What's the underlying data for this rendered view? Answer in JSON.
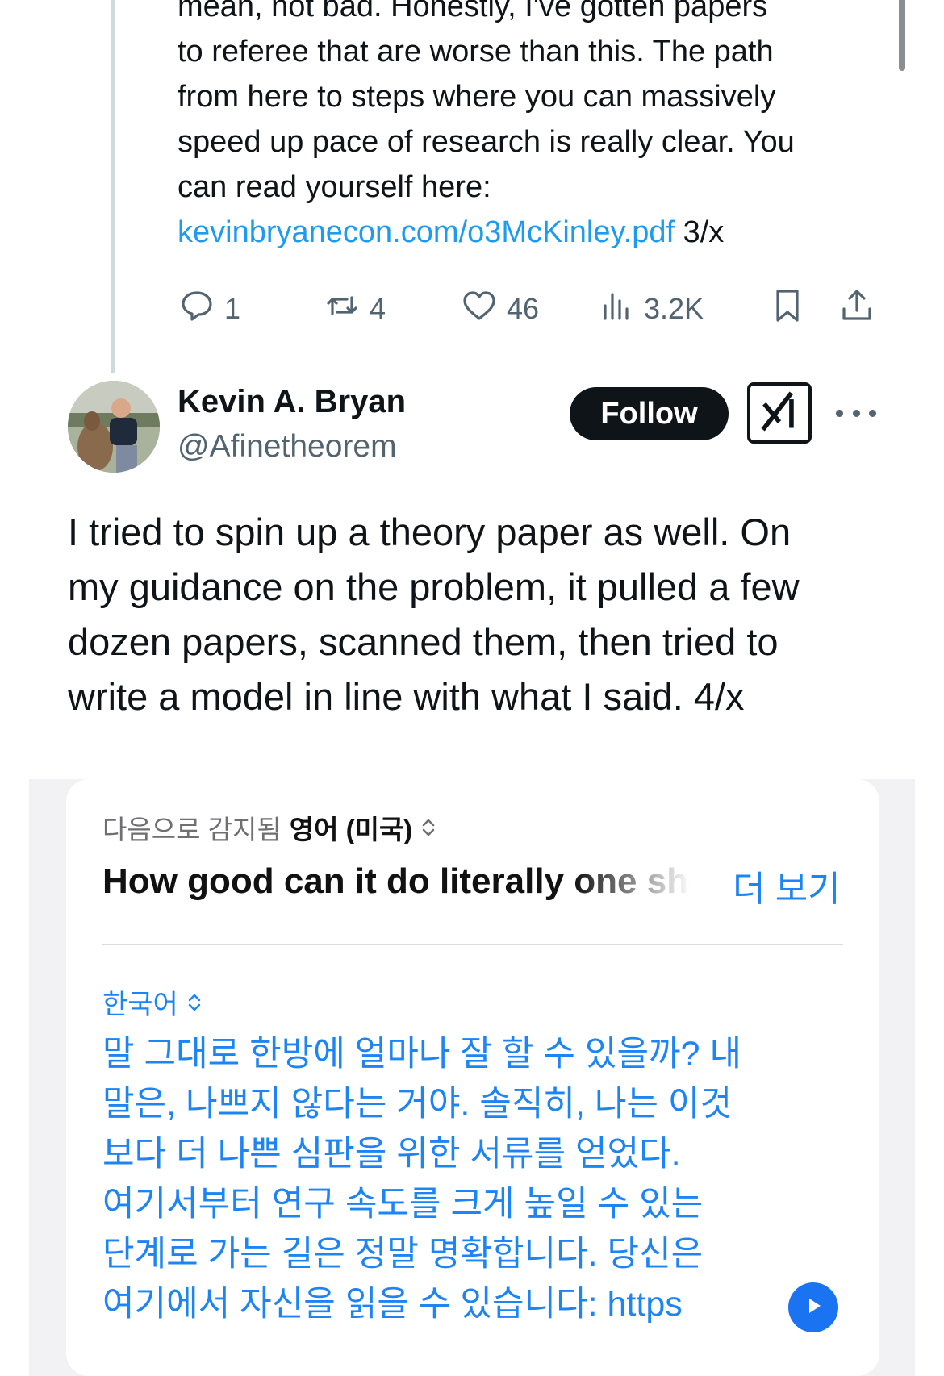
{
  "prev_tweet": {
    "lines": [
      "mean, not bad. Honestly, I've gotten papers",
      "to referee that are worse than this. The path",
      "from here to steps where you can massively",
      "speed up pace of research is really clear. You",
      "can read yourself here:"
    ],
    "link_text": "kevinbryanecon.com/o3McKinley.pdf",
    "suffix": " 3/x",
    "actions": {
      "replies": "1",
      "reposts": "4",
      "likes": "46",
      "views": "3.2K"
    }
  },
  "tweet": {
    "author_name": "Kevin A. Bryan",
    "author_handle": "@Afinetheorem",
    "follow_label": "Follow",
    "lines": [
      "I tried to spin up a theory paper as well. On",
      "my guidance on the problem, it pulled a few",
      "dozen papers, scanned them, then tried to",
      "write a model in line with what I said.  4/x"
    ]
  },
  "translation": {
    "detected_prefix": "다음으로 감지됨",
    "detected_language": "영어 (미국)",
    "source_text": "How good can it do literally one shot?",
    "see_more": "더 보기",
    "target_language": "한국어",
    "target_lines": [
      "말 그대로 한방에 얼마나 잘 할 수 있을까? 내",
      "말은, 나쁘지 않다는 거야. 솔직히, 나는 이것",
      "보다 더 나쁜 심판을 위한 서류를 얻었다.",
      "여기서부터 연구 속도를 크게 높일 수 있는",
      "단계로 가는 길은 정말 명확합니다. 당신은",
      "여기에서 자신을 읽을 수 있습니다: https"
    ]
  },
  "colors": {
    "link_blue": "#1d9bf0",
    "translate_blue": "#1d84f5",
    "text_dark": "#0f1419",
    "text_gray": "#536471"
  }
}
